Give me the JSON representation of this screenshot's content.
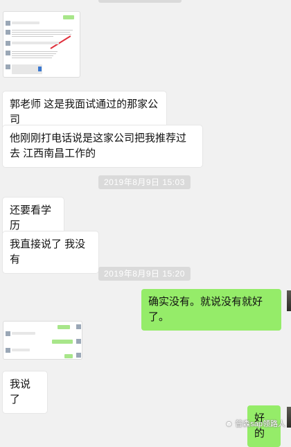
{
  "messages": {
    "m1": "郭老师 这是我面试通过的那家公司",
    "m2": "他刚刚打电话说是这家公司把我推荐过去 江西南昌工作的",
    "m3": "还要看学历",
    "m4": "我直接说了 我没有",
    "m5": "确实没有。就说没有就好了。",
    "m6": "我说了",
    "m7": "好的"
  },
  "timestamps": {
    "t1": "2019年8月9日 15:03",
    "t2": "2019年8月9日 15:20"
  },
  "watermark": "普森sap领路人",
  "colors": {
    "outgoing": "#95ec69",
    "incoming": "#ffffff",
    "background": "#f1f1f1"
  }
}
